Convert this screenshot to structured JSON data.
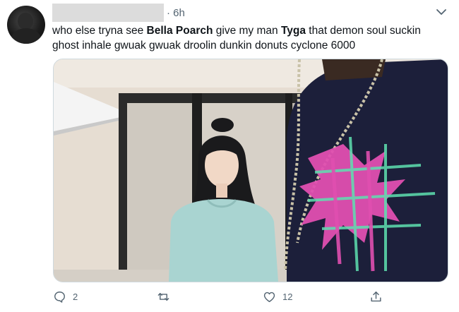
{
  "tweet": {
    "time": "6h",
    "text_parts": [
      {
        "text": "who else tryna see ",
        "bold": false
      },
      {
        "text": "Bella Poarch",
        "bold": true
      },
      {
        "text": " give my man ",
        "bold": false
      },
      {
        "text": "Tyga",
        "bold": true
      },
      {
        "text": " that demon soul suckin ghost inhale gwuak gwuak droolin dunkin donuts cyclone 6000",
        "bold": false
      }
    ],
    "reply_count": "2",
    "retweet_count": "",
    "like_count": "12"
  },
  "colors": {
    "text": "#0f1419",
    "secondary": "#536471",
    "border": "#cfd9de"
  },
  "icons": [
    "caret-down-icon",
    "reply-icon",
    "retweet-icon",
    "like-icon",
    "share-icon"
  ]
}
